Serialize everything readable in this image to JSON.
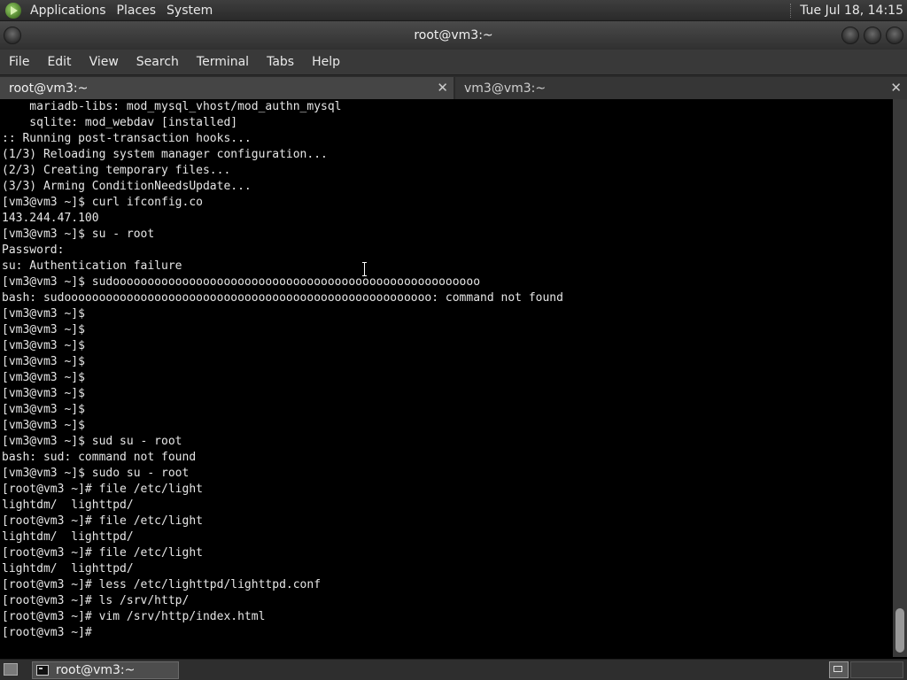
{
  "top_panel": {
    "menus": [
      "Applications",
      "Places",
      "System"
    ],
    "clock": "Tue Jul 18, 14:15"
  },
  "window": {
    "title": "root@vm3:~"
  },
  "menubar": {
    "items": [
      "File",
      "Edit",
      "View",
      "Search",
      "Terminal",
      "Tabs",
      "Help"
    ]
  },
  "tabs": [
    {
      "label": "root@vm3:~",
      "active": true
    },
    {
      "label": "vm3@vm3:~",
      "active": false
    }
  ],
  "terminal": {
    "lines": [
      "    mariadb-libs: mod_mysql_vhost/mod_authn_mysql",
      "    sqlite: mod_webdav [installed]",
      ":: Running post-transaction hooks...",
      "(1/3) Reloading system manager configuration...",
      "(2/3) Creating temporary files...",
      "(3/3) Arming ConditionNeedsUpdate...",
      "[vm3@vm3 ~]$ curl ifconfig.co",
      "143.244.47.100",
      "[vm3@vm3 ~]$ su - root",
      "Password:",
      "su: Authentication failure",
      "[vm3@vm3 ~]$ sudooooooooooooooooooooooooooooooooooooooooooooooooooooo",
      "bash: sudooooooooooooooooooooooooooooooooooooooooooooooooooooo: command not found",
      "[vm3@vm3 ~]$",
      "[vm3@vm3 ~]$",
      "[vm3@vm3 ~]$",
      "[vm3@vm3 ~]$",
      "[vm3@vm3 ~]$",
      "[vm3@vm3 ~]$",
      "[vm3@vm3 ~]$",
      "[vm3@vm3 ~]$",
      "[vm3@vm3 ~]$ sud su - root",
      "bash: sud: command not found",
      "[vm3@vm3 ~]$ sudo su - root",
      "[root@vm3 ~]# file /etc/light",
      "lightdm/  lighttpd/",
      "[root@vm3 ~]# file /etc/light",
      "lightdm/  lighttpd/",
      "[root@vm3 ~]# file /etc/light",
      "lightdm/  lighttpd/",
      "[root@vm3 ~]# less /etc/lighttpd/lighttpd.conf",
      "[root@vm3 ~]# ls /srv/http/",
      "[root@vm3 ~]# vim /srv/http/index.html",
      "[root@vm3 ~]#"
    ]
  },
  "taskbar": {
    "task_label": "root@vm3:~"
  }
}
